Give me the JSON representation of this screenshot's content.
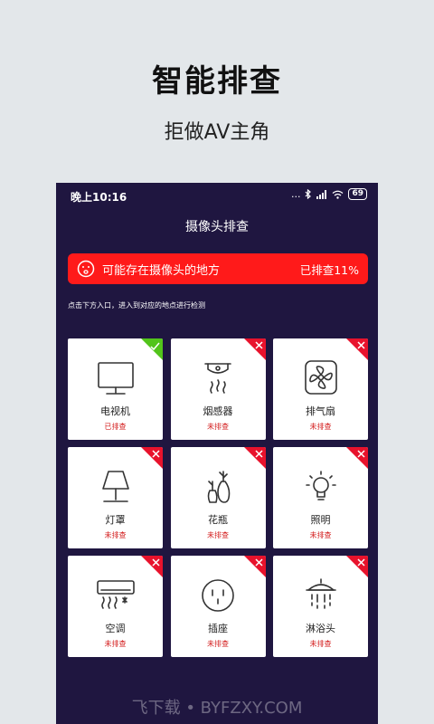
{
  "promo": {
    "title": "智能排查",
    "subtitle": "拒做AV主角"
  },
  "statusbar": {
    "time": "晚上10:16",
    "signal": "...",
    "battery": "69"
  },
  "app": {
    "title": "摄像头排查"
  },
  "alert": {
    "text": "可能存在摄像头的地方",
    "progress": "已排查11%"
  },
  "hint": "点击下方入口，进入到对应的地点进行检测",
  "items": [
    {
      "label": "电视机",
      "status": "已排查",
      "checked": true,
      "icon": "tv-icon"
    },
    {
      "label": "烟感器",
      "status": "未排查",
      "checked": false,
      "icon": "smoke-detector-icon"
    },
    {
      "label": "排气扇",
      "status": "未排查",
      "checked": false,
      "icon": "exhaust-fan-icon"
    },
    {
      "label": "灯罩",
      "status": "未排查",
      "checked": false,
      "icon": "lampshade-icon"
    },
    {
      "label": "花瓶",
      "status": "未排查",
      "checked": false,
      "icon": "vase-icon"
    },
    {
      "label": "照明",
      "status": "未排查",
      "checked": false,
      "icon": "light-bulb-icon"
    },
    {
      "label": "空调",
      "status": "未排查",
      "checked": false,
      "icon": "air-conditioner-icon"
    },
    {
      "label": "插座",
      "status": "未排查",
      "checked": false,
      "icon": "socket-icon"
    },
    {
      "label": "淋浴头",
      "status": "未排查",
      "checked": false,
      "icon": "shower-head-icon"
    }
  ],
  "colors": {
    "background": "#1f1640",
    "alert": "#ff1a1a",
    "checked": "#52c41a",
    "unchecked": "#e8122c"
  },
  "watermark": "飞下载 • BYFZXY.COM"
}
